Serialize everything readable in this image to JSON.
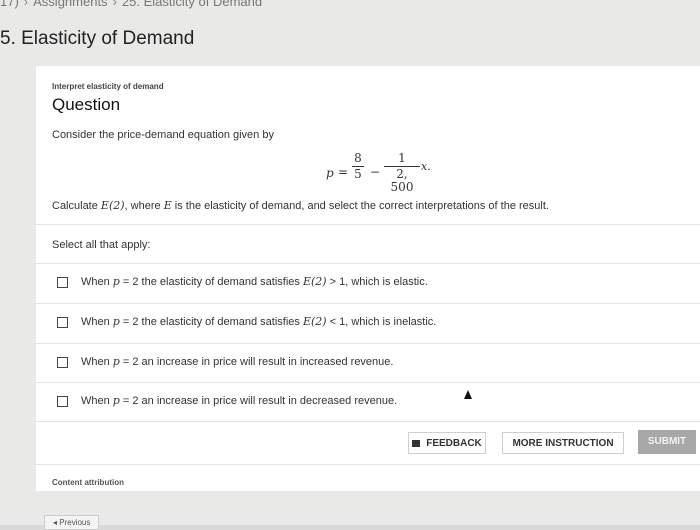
{
  "breadcrumb": {
    "items": [
      "17)",
      "Assignments",
      "25. Elasticity of Demand"
    ]
  },
  "page_title": "5. Elasticity of Demand",
  "question": {
    "eyebrow": "Interpret elasticity of demand",
    "heading": "Question",
    "prompt": "Consider the price-demand equation given by",
    "equation": {
      "lhs": "p",
      "eq": "=",
      "frac1_num": "8",
      "frac1_den": "5",
      "minus": "−",
      "frac2_num": "1",
      "frac2_den": "2, 500",
      "x": "x."
    },
    "calc": {
      "pre": "Calculate ",
      "fn": "E(2)",
      "mid": ", where ",
      "var": "E",
      "post": " is the elasticity of demand, and select the correct interpretations of the result."
    },
    "select_label": "Select all that apply:",
    "options": [
      {
        "a": "When ",
        "b": "p",
        "c": " = 2 the elasticity of demand satisfies ",
        "d": "E(2)",
        "e": " > 1, which is elastic."
      },
      {
        "a": "When ",
        "b": "p",
        "c": " = 2 the elasticity of demand satisfies ",
        "d": "E(2)",
        "e": " < 1, which is inelastic."
      },
      {
        "a": "When ",
        "b": "p",
        "c": " = 2 an increase in price will result in increased revenue."
      },
      {
        "a": "When ",
        "b": "p",
        "c": " = 2 an increase in price will result in decreased revenue."
      }
    ]
  },
  "buttons": {
    "feedback": "FEEDBACK",
    "more_instruction": "MORE INSTRUCTION",
    "submit": "SUBMIT"
  },
  "footer": {
    "attribution": "Content attribution",
    "previous": "◂ Previous"
  }
}
